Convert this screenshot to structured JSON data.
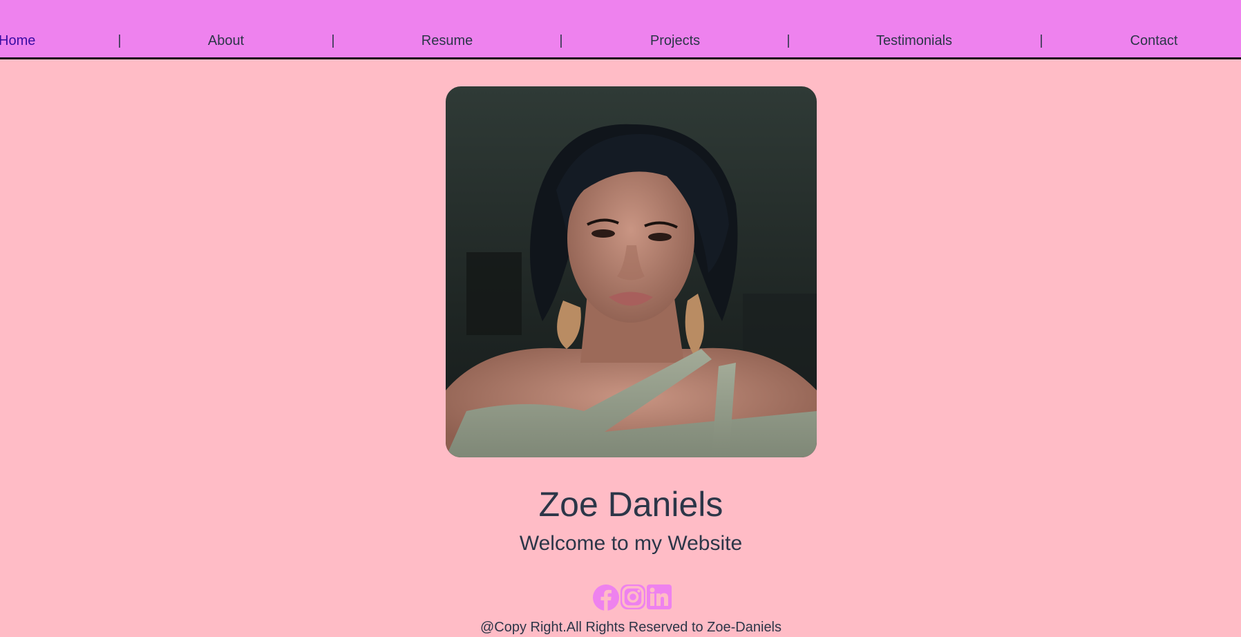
{
  "nav": {
    "items": [
      {
        "label": "Home",
        "active": true
      },
      {
        "label": "About"
      },
      {
        "label": "Resume"
      },
      {
        "label": "Projects"
      },
      {
        "label": "Testimonials"
      },
      {
        "label": "Contact"
      }
    ],
    "separator": "|"
  },
  "hero": {
    "name": "Zoe Daniels",
    "tagline": "Welcome to my Website"
  },
  "socials": [
    "facebook-icon",
    "instagram-icon",
    "linkedin-icon"
  ],
  "footer": {
    "text": "@Copy Right.All Rights Reserved to Zoe-Daniels"
  },
  "colors": {
    "background": "#ffbcc6",
    "navbar": "#ee82ee",
    "text": "#2c3648",
    "active_link": "#3a0ca3",
    "icon": "#ee82ee"
  }
}
